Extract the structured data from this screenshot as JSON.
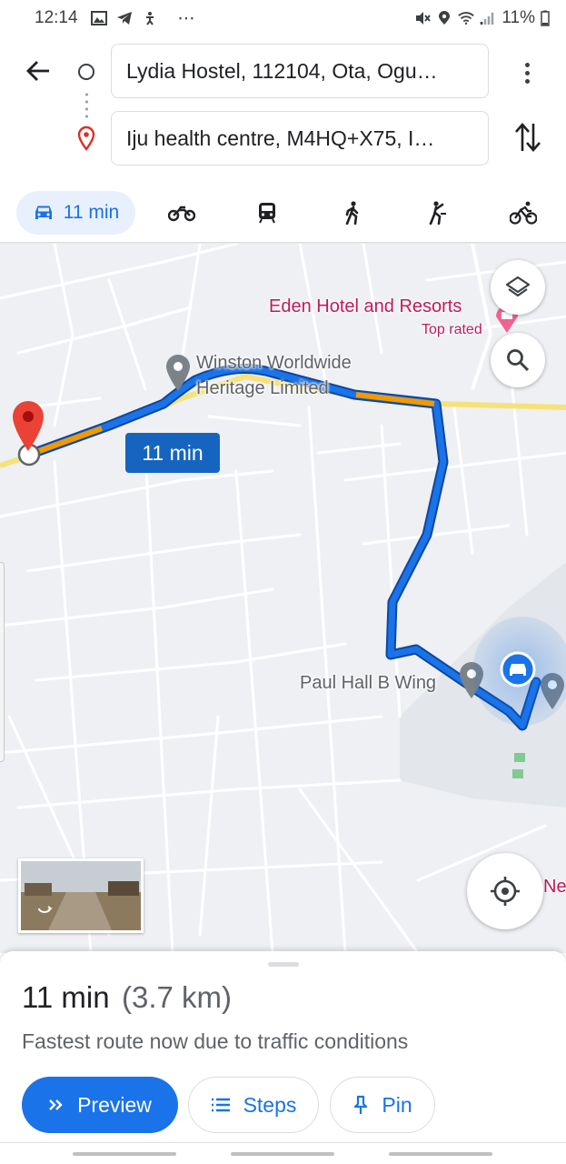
{
  "status_bar": {
    "time": "12:14",
    "more": "⋯",
    "battery": "11%"
  },
  "directions": {
    "origin": "Lydia Hostel, 112104, Ota, Ogu…",
    "destination": "Iju health centre, M4HQ+X75, I…",
    "modes": [
      {
        "name": "car-icon",
        "label": "11 min",
        "selected": true
      },
      {
        "name": "motorcycle-icon"
      },
      {
        "name": "transit-icon"
      },
      {
        "name": "walk-icon"
      },
      {
        "name": "ride-icon"
      },
      {
        "name": "bike-icon"
      }
    ]
  },
  "map": {
    "labels": {
      "eden": "Eden Hotel and Resorts",
      "eden_tag": "Top rated",
      "winston_1": "Winston Worldwide",
      "winston_2": "Heritage Limited",
      "paul": "Paul Hall B Wing",
      "edge": "Ne"
    },
    "eta_badge": "11 min",
    "route_color": "#1a73e8",
    "traffic_color": "#f29900"
  },
  "summary": {
    "duration": "11 min",
    "distance": "(3.7 km)",
    "note": "Fastest route now due to traffic conditions",
    "preview_label": "Preview",
    "steps_label": "Steps",
    "pin_label": "Pin"
  }
}
